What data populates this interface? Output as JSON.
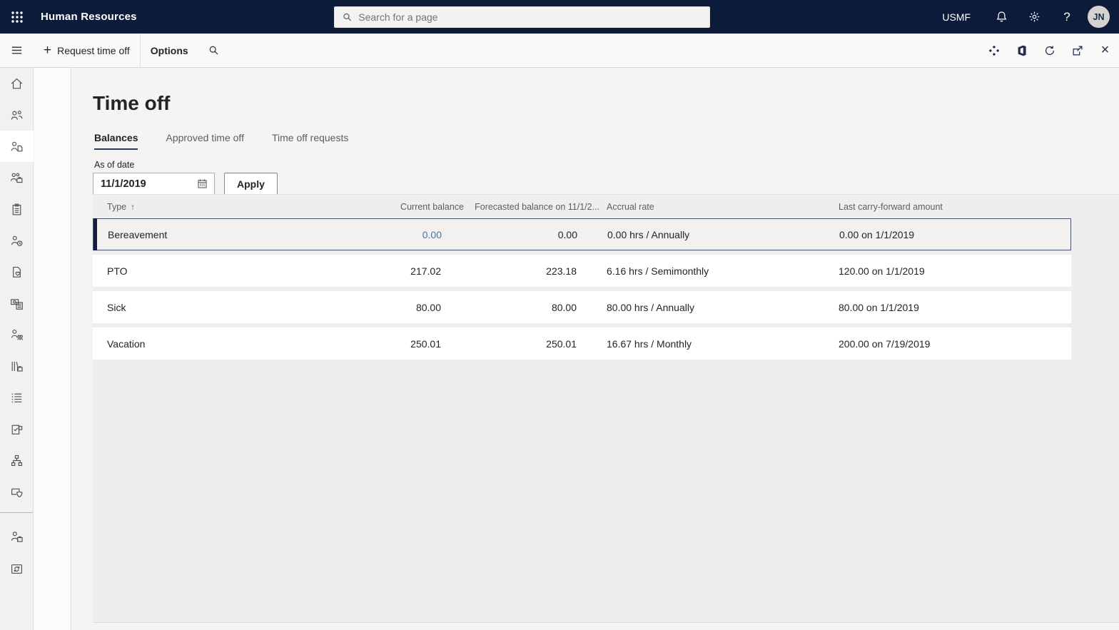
{
  "colors": {
    "topbar_bg": "#0d1b3a",
    "selected_row_border": "#48536f",
    "selected_row_accent": "#141f3c",
    "link_blue": "#4673ad",
    "tab_underline": "#2c3a5e"
  },
  "topbar": {
    "app_title": "Human Resources",
    "search_placeholder": "Search for a page",
    "company": "USMF",
    "user_initials": "JN",
    "icons": [
      "waffle-icon",
      "bell-icon",
      "gear-icon",
      "help-icon",
      "avatar"
    ]
  },
  "toolbar": {
    "request_time_off_label": "Request time off",
    "plus_glyph": "+",
    "options_label": "Options",
    "right_icons": [
      "diamonds-icon",
      "office-icon",
      "refresh-icon",
      "popout-icon",
      "close-icon"
    ],
    "close_glyph": "×"
  },
  "sidebar": {
    "items": [
      {
        "icon": "home-icon",
        "active": false
      },
      {
        "icon": "people-icon",
        "active": false
      },
      {
        "icon": "person-document-icon",
        "active": true
      },
      {
        "icon": "people-briefcase-icon",
        "active": false
      },
      {
        "icon": "clipboard-icon",
        "active": false
      },
      {
        "icon": "person-clock-icon",
        "active": false
      },
      {
        "icon": "document-heart-icon",
        "active": false
      },
      {
        "icon": "payroll-icon",
        "active": false
      },
      {
        "icon": "person-people-icon",
        "active": false
      },
      {
        "icon": "books-briefcase-icon",
        "active": false
      },
      {
        "icon": "list-icon",
        "active": false
      },
      {
        "icon": "clipboard-check-icon",
        "active": false
      },
      {
        "icon": "org-chart-icon",
        "active": false
      },
      {
        "icon": "shield-panel-icon",
        "active": false
      },
      {
        "icon": "divider",
        "active": false
      },
      {
        "icon": "person-briefcase-icon",
        "active": false
      },
      {
        "icon": "box-sync-icon",
        "active": false
      }
    ]
  },
  "page": {
    "title": "Time off",
    "tabs": [
      {
        "label": "Balances",
        "active": true
      },
      {
        "label": "Approved time off",
        "active": false
      },
      {
        "label": "Time off requests",
        "active": false
      }
    ],
    "as_of_date_label": "As of date",
    "as_of_date_value": "11/1/2019",
    "apply_label": "Apply"
  },
  "grid": {
    "columns": {
      "type": "Type",
      "sort_glyph": "↑",
      "current_balance": "Current balance",
      "forecasted": "Forecasted balance on 11/1/2...",
      "accrual": "Accrual rate",
      "carry_forward": "Last carry-forward amount"
    },
    "rows": [
      {
        "type": "Bereavement",
        "current_balance": "0.00",
        "forecasted": "0.00",
        "accrual": "0.00 hrs / Annually",
        "carry_forward": "0.00 on 1/1/2019",
        "selected": true,
        "balance_is_link": true
      },
      {
        "type": "PTO",
        "current_balance": "217.02",
        "forecasted": "223.18",
        "accrual": "6.16 hrs / Semimonthly",
        "carry_forward": "120.00 on 1/1/2019",
        "selected": false,
        "balance_is_link": false
      },
      {
        "type": "Sick",
        "current_balance": "80.00",
        "forecasted": "80.00",
        "accrual": "80.00 hrs / Annually",
        "carry_forward": "80.00 on 1/1/2019",
        "selected": false,
        "balance_is_link": false
      },
      {
        "type": "Vacation",
        "current_balance": "250.01",
        "forecasted": "250.01",
        "accrual": "16.67 hrs / Monthly",
        "carry_forward": "200.00 on 7/19/2019",
        "selected": false,
        "balance_is_link": false
      }
    ]
  }
}
